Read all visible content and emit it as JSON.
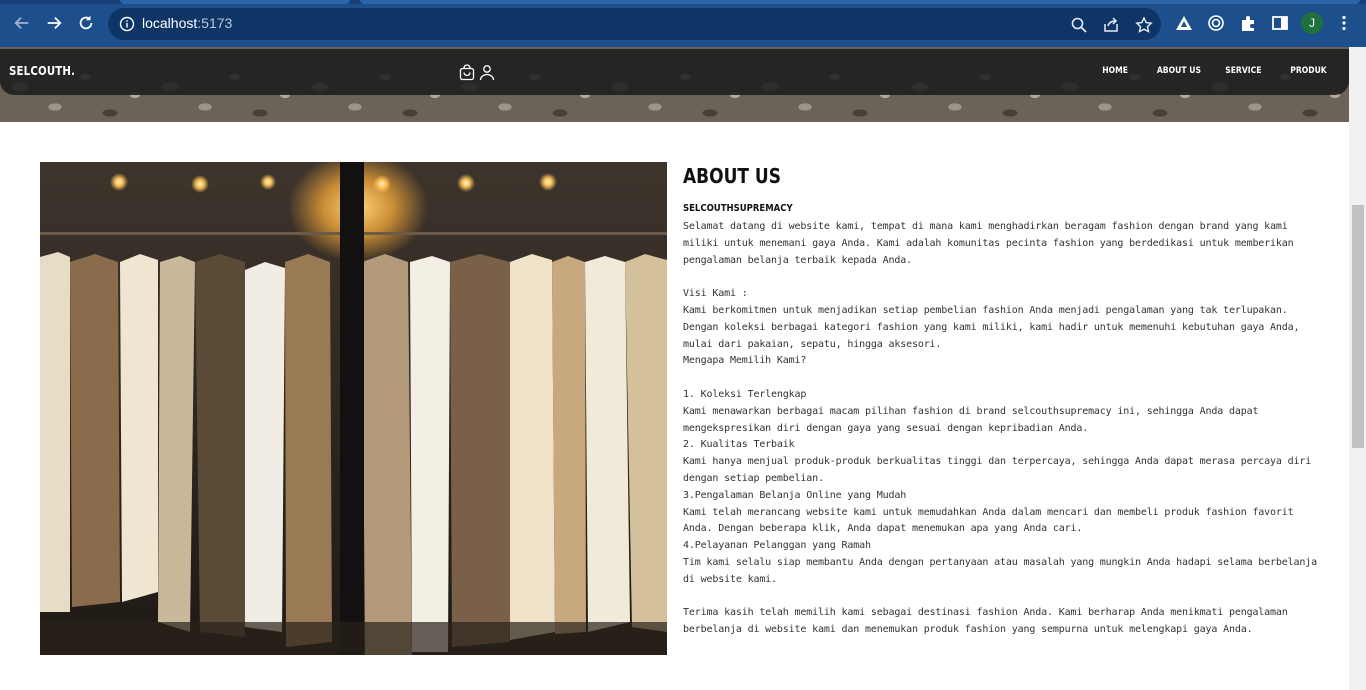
{
  "browser": {
    "url_host": "localhost",
    "url_port": ":5173",
    "profile_initial": "J",
    "icons": [
      "back-icon",
      "forward-icon",
      "reload-icon",
      "info-icon",
      "zoom-icon",
      "share-icon",
      "star-icon",
      "extension-triangle-icon",
      "extension-target-icon",
      "puzzle-icon",
      "sidepanel-icon",
      "kebab-menu-icon"
    ]
  },
  "navbar": {
    "brand": "SELCOUTH.",
    "icons": [
      "bag-icon",
      "user-icon"
    ],
    "menu": [
      "HOME",
      "ABOUT US",
      "SERVICE",
      "PRODUK"
    ]
  },
  "about": {
    "title": "ABOUT US",
    "subtitle": "SELCOUTHSUPREMACY",
    "p_intro": "Selamat datang di website kami, tempat di mana kami menghadirkan beragam fashion dengan brand yang kami miliki untuk menemani gaya Anda. Kami adalah komunitas pecinta fashion yang berdedikasi untuk memberikan pengalaman belanja terbaik kepada Anda.",
    "p_visi": "Visi Kami :\nKami berkomitmen untuk menjadikan setiap pembelian fashion Anda menjadi pengalaman yang tak terlupakan. Dengan koleksi berbagai kategori fashion yang kami miliki, kami hadir untuk memenuhi kebutuhan gaya Anda, mulai dari pakaian, sepatu, hingga aksesori.\nMengapa Memilih Kami?",
    "p_points": "1. Koleksi Terlengkap\nKami menawarkan berbagai macam pilihan fashion di brand selcouthsupremacy ini, sehingga Anda dapat mengekspresikan diri dengan gaya yang sesuai dengan kepribadian Anda.\n2. Kualitas Terbaik\nKami hanya menjual produk-produk berkualitas tinggi dan terpercaya, sehingga Anda dapat merasa percaya diri dengan setiap pembelian.\n3.Pengalaman Belanja Online yang Mudah\nKami telah merancang website kami untuk memudahkan Anda dalam mencari dan membeli produk fashion favorit Anda. Dengan beberapa klik, Anda dapat menemukan apa yang Anda cari.\n4.Pelayanan Pelanggan yang Ramah\nTim kami selalu siap membantu Anda dengan pertanyaan atau masalah yang mungkin Anda hadapi selama berbelanja di website kami.",
    "p_thanks": "Terima kasih telah memilih kami sebagai destinasi fashion Anda. Kami berharap Anda menikmati pengalaman berbelanja di website kami dan menemukan produk fashion yang sempurna untuk melengkapi gaya Anda."
  }
}
